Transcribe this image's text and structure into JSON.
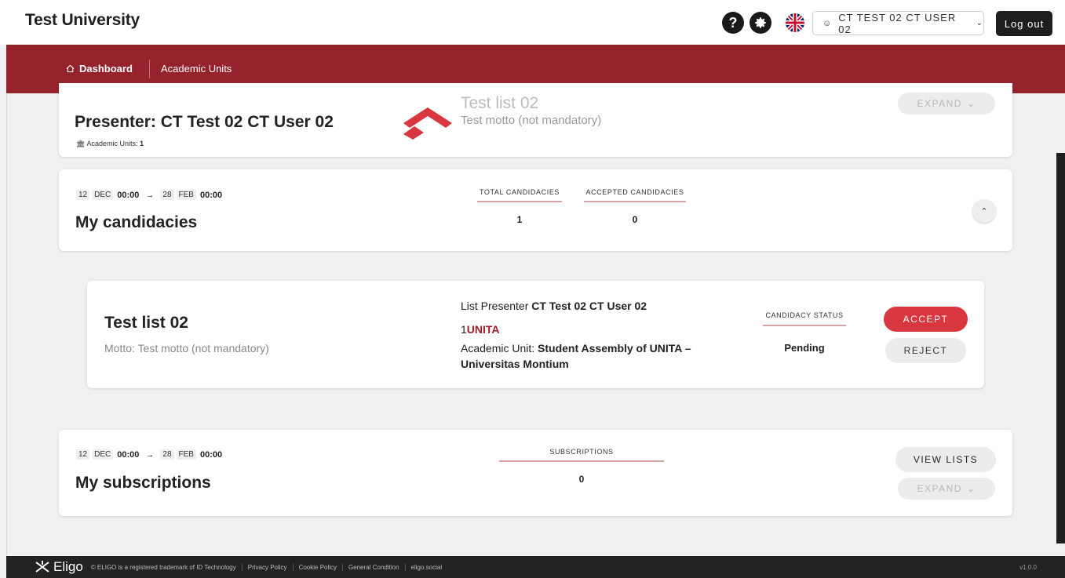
{
  "header": {
    "title": "Test University",
    "help_icon": "?",
    "user_label": "CT TEST 02 CT USER 02",
    "logout_label": "Log out"
  },
  "nav": {
    "dashboard_label": "Dashboard",
    "academic_units_label": "Academic Units"
  },
  "presenter_card": {
    "title": "Presenter: CT Test 02 CT User 02",
    "academic_units_label": "Academic Units: ",
    "academic_units_count": "1",
    "list_title": "Test list 02",
    "motto": "Test motto (not mandatory)",
    "expand_label": "EXPAND"
  },
  "candidacies_card": {
    "start_day": "12",
    "start_month": "DEC",
    "start_time": "00:00",
    "end_day": "28",
    "end_month": "FEB",
    "end_time": "00:00",
    "title": "My candidacies",
    "total_label": "TOTAL CANDIDACIES",
    "total_value": "1",
    "accepted_label": "ACCEPTED CANDIDACIES",
    "accepted_value": "0"
  },
  "candidacy_item": {
    "title": "Test list 02",
    "motto": "Motto: Test motto (not mandatory)",
    "presenter_prefix": "List Presenter ",
    "presenter_name": "CT Test 02 CT User 02",
    "unita_number": "1",
    "unita_name": "UNITA",
    "au_prefix": "Academic Unit: ",
    "au_name": "Student Assembly of UNITA – Universitas Montium",
    "status_label": "CANDIDACY STATUS",
    "status_value": "Pending",
    "accept_label": "ACCEPT",
    "reject_label": "REJECT"
  },
  "subscriptions_card": {
    "start_day": "12",
    "start_month": "DEC",
    "start_time": "00:00",
    "end_day": "28",
    "end_month": "FEB",
    "end_time": "00:00",
    "title": "My subscriptions",
    "subs_label": "SUBSCRIPTIONS",
    "subs_value": "0",
    "view_lists_label": "VIEW LISTS",
    "expand_label": "EXPAND"
  },
  "footer": {
    "brand": "Eligo",
    "trademark": "© ELIGO is a registered trademark of ID Technology",
    "privacy": "Privacy Policy",
    "cookie": "Cookie Policy",
    "general": "General Condition",
    "site": "eligo.social",
    "version": "v1.0.0"
  },
  "colors": {
    "brand_red": "#96232b",
    "accept_red": "#d9373f",
    "unita_red": "#a01e28"
  }
}
